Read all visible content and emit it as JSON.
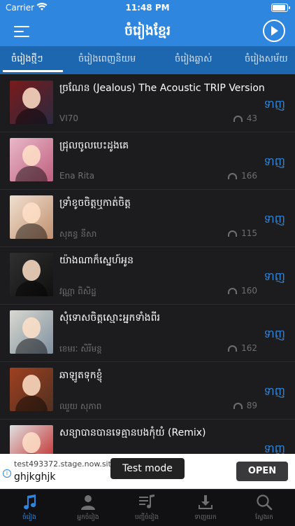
{
  "status": {
    "carrier": "Carrier",
    "time": "11:48 PM"
  },
  "header": {
    "title": "ចំរៀងខ្មែរ"
  },
  "tabs": [
    {
      "label": "ចំរៀងថ្មីៗ"
    },
    {
      "label": "ចំរៀងពេញនិយម"
    },
    {
      "label": "ចំរៀងឆ្លាស់"
    },
    {
      "label": "ចំរៀងសម័យ"
    }
  ],
  "download_label": "ទាញ",
  "songs": [
    {
      "title": "ច្រណែន (Jealous) The Acoustic TRIP Version",
      "artist": "VI70",
      "plays": "43",
      "colors": [
        "#7a1a1a",
        "#2a2a40"
      ]
    },
    {
      "title": "ជ្រុលចូលបេះដូងគេ",
      "artist": "Ena Rita",
      "plays": "166",
      "colors": [
        "#e8b8c8",
        "#c06080"
      ]
    },
    {
      "title": "ទ្រាំខូចចិត្តឬកាត់ចិត្ត",
      "artist": "សុគន្ធ នីសា",
      "plays": "115",
      "colors": [
        "#f0e0d0",
        "#c09070"
      ]
    },
    {
      "title": "យ៉ាងណាក៏ស្នេហ៍អូន",
      "artist": "វណ្ណា ពិសិដ្ឋ",
      "plays": "160",
      "colors": [
        "#303030",
        "#101010"
      ]
    },
    {
      "title": "សុំទោសចិត្តស្មោះអ្នកទាំងពីរ",
      "artist": "ខេមរៈ សិរីមន្ត",
      "plays": "162",
      "colors": [
        "#d8d8d0",
        "#8090a0"
      ]
    },
    {
      "title": "ឆាឡូតទុកខ្ញុំ",
      "artist": "ឈួយ សុភាព",
      "plays": "89",
      "colors": [
        "#a04020",
        "#503020"
      ]
    },
    {
      "title": "សន្យាបានបានទេគ្មានបងកុំយំ (Remix)",
      "artist": "",
      "plays": "",
      "colors": [
        "#e0e0e0",
        "#c02020"
      ]
    }
  ],
  "ad": {
    "url": "test493372.stage.now.site",
    "name": "ghjkghjk",
    "test_mode": "Test mode",
    "open": "OPEN"
  },
  "tabbar": [
    {
      "label": "ចំរៀង",
      "icon": "music-note-icon"
    },
    {
      "label": "អ្នកចំរៀង",
      "icon": "singer-icon"
    },
    {
      "label": "បញ្ជីចំរៀង",
      "icon": "playlist-icon"
    },
    {
      "label": "ទាញយក",
      "icon": "download-icon"
    },
    {
      "label": "ស្វែងរក",
      "icon": "search-icon"
    }
  ],
  "colors": {
    "accent": "#2e86de",
    "tab_bg": "#1d67b0",
    "list_bg": "#1c1c1e"
  }
}
